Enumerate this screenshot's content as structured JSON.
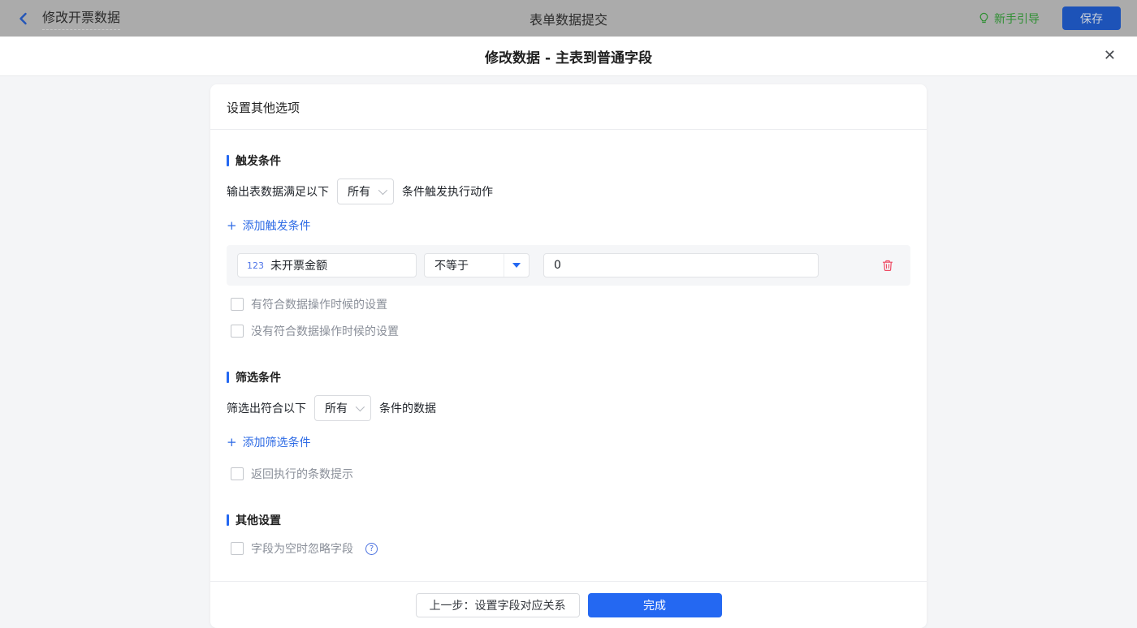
{
  "topbar": {
    "back_label": "修改开票数据",
    "center_title": "表单数据提交",
    "guide_label": "新手引导",
    "save_label": "保存"
  },
  "modal": {
    "title": "修改数据 - 主表到普通字段",
    "close_glyph": "✕"
  },
  "card": {
    "header": "设置其他选项",
    "trigger": {
      "section_title": "触发条件",
      "sentence_prefix": "输出表数据满足以下",
      "select_value": "所有",
      "sentence_suffix": "条件触发执行动作",
      "add_plus": "+",
      "add_link": "添加触发条件",
      "condition": {
        "field_type": "123",
        "field_name": "未开票金额",
        "operator": "不等于",
        "value": "0"
      },
      "checkbox_has_match": "有符合数据操作时候的设置",
      "checkbox_no_match": "没有符合数据操作时候的设置"
    },
    "filter": {
      "section_title": "筛选条件",
      "sentence_prefix": "筛选出符合以下",
      "select_value": "所有",
      "sentence_suffix": "条件的数据",
      "add_plus": "+",
      "add_link": "添加筛选条件",
      "checkbox_count_tip": "返回执行的条数提示"
    },
    "other": {
      "section_title": "其他设置",
      "checkbox_ignore_empty": "字段为空时忽略字段",
      "help_glyph": "?"
    },
    "footer": {
      "prev_label": "上一步：设置字段对应关系",
      "done_label": "完成"
    }
  },
  "colors": {
    "accent_blue": "#2468f2",
    "link_blue": "#2e6be5",
    "danger_red": "#ee4a63",
    "guide_green": "#2f8f33",
    "dimmed_bar": "#ababab",
    "page_bg": "#f4f5f7"
  }
}
